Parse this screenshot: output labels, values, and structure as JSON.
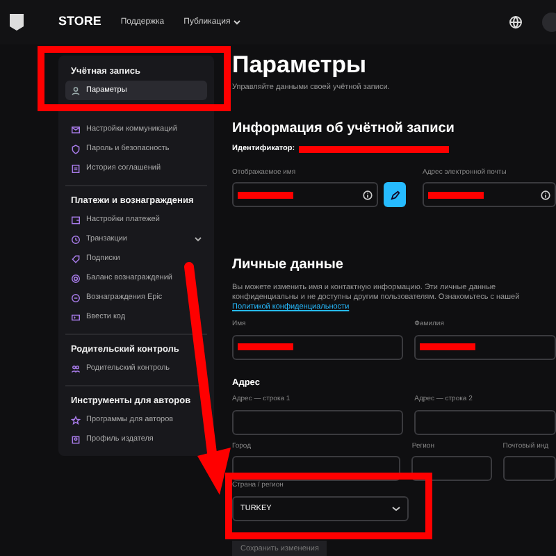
{
  "top_nav": {
    "brand": "STORE",
    "links": [
      {
        "label": "Поддержка",
        "has_menu": false
      },
      {
        "label": "Публикация",
        "has_menu": true
      }
    ]
  },
  "sidebar": {
    "sections": [
      {
        "title": "Учётная запись",
        "items": [
          {
            "label": "Параметры",
            "selected": true,
            "expandable": false
          }
        ]
      },
      {
        "items": [
          {
            "label": "Настройки коммуникаций",
            "selected": false,
            "expandable": false
          },
          {
            "label": "Пароль и безопасность",
            "selected": false,
            "expandable": false
          },
          {
            "label": "История соглашений",
            "selected": false,
            "expandable": false
          }
        ]
      },
      {
        "title": "Платежи и вознаграждения",
        "items": [
          {
            "label": "Настройки платежей",
            "selected": false,
            "expandable": false
          },
          {
            "label": "Транзакции",
            "selected": false,
            "expandable": true
          },
          {
            "label": "Подписки",
            "selected": false,
            "expandable": false
          },
          {
            "label": "Баланс вознаграждений",
            "selected": false,
            "expandable": false
          },
          {
            "label": "Вознаграждения Epic",
            "selected": false,
            "expandable": false
          },
          {
            "label": "Ввести код",
            "selected": false,
            "expandable": false
          }
        ]
      },
      {
        "title": "Родительский контроль",
        "items": [
          {
            "label": "Родительский контроль",
            "selected": false,
            "expandable": false
          }
        ]
      },
      {
        "title": "Инструменты для авторов",
        "items": [
          {
            "label": "Программы для авторов",
            "selected": false,
            "expandable": false
          },
          {
            "label": "Профиль издателя",
            "selected": false,
            "expandable": false
          }
        ]
      }
    ]
  },
  "page": {
    "title": "Параметры",
    "subtitle": "Управляйте данными своей учётной записи.",
    "account": {
      "title": "Информация об учётной записи",
      "id_label": "Идентификатор:",
      "fields": [
        {
          "label": "Отображаемое имя",
          "redacted": true
        },
        {
          "label": "Адрес электронной почты",
          "redacted": true
        }
      ]
    },
    "personal": {
      "title": "Личные данные",
      "text": "Вы можете изменить имя и контактную информацию. Эти личные данные конфиденциальны и не доступны другим пользователям. Ознакомьтесь с нашей",
      "link": "Политикой конфиденциальности",
      "fields": [
        {
          "label": "Имя",
          "redacted": true
        },
        {
          "label": "Фамилия",
          "redacted": true
        }
      ]
    },
    "address": {
      "title": "Адрес",
      "line_fields": [
        {
          "label": "Адрес — строка 1"
        },
        {
          "label": "Адрес — строка 2"
        }
      ],
      "city_fields": [
        {
          "label": "Город"
        },
        {
          "label": "Регион"
        },
        {
          "label": "Почтовый инд"
        }
      ],
      "country": {
        "label": "Страна / регион",
        "value": "TURKEY"
      }
    },
    "save_button": "Сохранить изменения"
  }
}
